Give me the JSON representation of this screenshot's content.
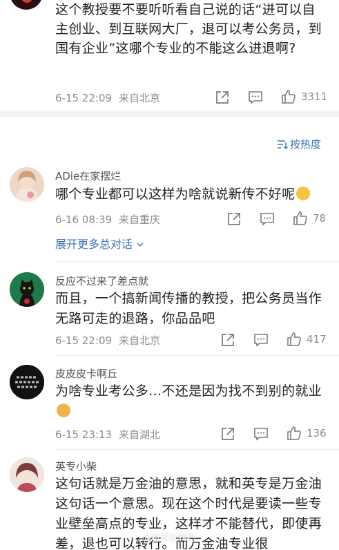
{
  "top_post": {
    "text": "这个教授要不要听听看自己说的话“进可以自主创业、到互联网大厂，退可以考公务员，到国有企业”这哪个专业的不能这么进退啊?",
    "date": "6-15 22:09",
    "location": "来自北京",
    "likes": "3311"
  },
  "sort_label": "按热度",
  "comments": [
    {
      "name": "ADie在家摆烂",
      "text": "哪个专业都可以这样为啥就说新传不好呢",
      "date": "6-16 08:39",
      "location": "来自重庆",
      "likes": "78",
      "expand": "展开更多总对话"
    },
    {
      "name": "反应不过来了差点就",
      "text": "而且，一个搞新闻传播的教授，把公务员当作无路可走的退路，你品品吧",
      "date": "6-15 22:09",
      "location": "来自北京",
      "likes": "417"
    },
    {
      "name": "皮皮皮卡啊丘",
      "text": "为啥专业考公多…不还是因为找不到别的就业",
      "date": "6-15 23:13",
      "location": "来自湖北",
      "likes": "136"
    },
    {
      "name": "英专小柴",
      "text": "这句话就是万金油的意思，就和英专是万金油这句话一个意思。现在这个时代是要读一些专业壁垒高点的专业，这样才不能替代，即使再差，退也可以转行。而万金油专业很"
    }
  ],
  "watermark": "@也可以转行",
  "colors": {
    "link": "#3d73b8",
    "meta": "#8c8c8c",
    "band": "#f2f2f2"
  },
  "icons": [
    "share-icon",
    "comment-icon",
    "like-icon",
    "sort-icon",
    "chevron-down-icon"
  ]
}
